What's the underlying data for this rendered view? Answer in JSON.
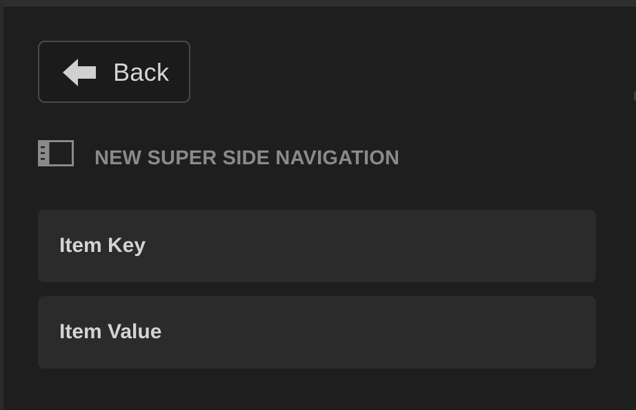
{
  "back_button": {
    "label": "Back",
    "icon": "arrow-left-icon"
  },
  "section": {
    "icon": "side-navigation-icon",
    "title": "NEW SUPER SIDE NAVIGATION"
  },
  "fields": [
    {
      "label": "Item Key"
    },
    {
      "label": "Item Value"
    }
  ],
  "colors": {
    "background": "#1e1e1e",
    "field_background": "#2b2b2b",
    "text_primary": "#d4d4d4",
    "text_muted": "#8a8a8a",
    "border": "#4a4a4a"
  }
}
